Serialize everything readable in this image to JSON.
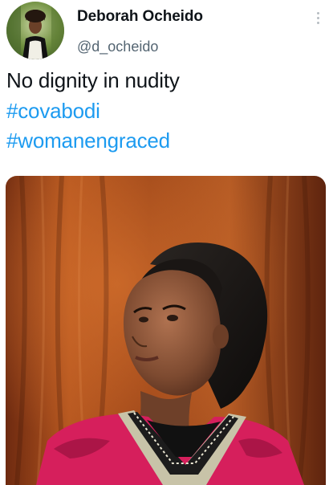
{
  "author": {
    "display_name": "Deborah Ocheido",
    "handle": "@d_ocheido",
    "avatar_icon": "profile-photo"
  },
  "menu": {
    "icon": "more-vertical-icon"
  },
  "tweet": {
    "line1": "No dignity in nudity",
    "hashtag1": "#covabodi",
    "hashtag2": "#womanengraced"
  },
  "colors": {
    "hashtag": "#1d9bf0",
    "handle": "#536471",
    "text": "#0f1419"
  },
  "media": {
    "type": "photo"
  }
}
